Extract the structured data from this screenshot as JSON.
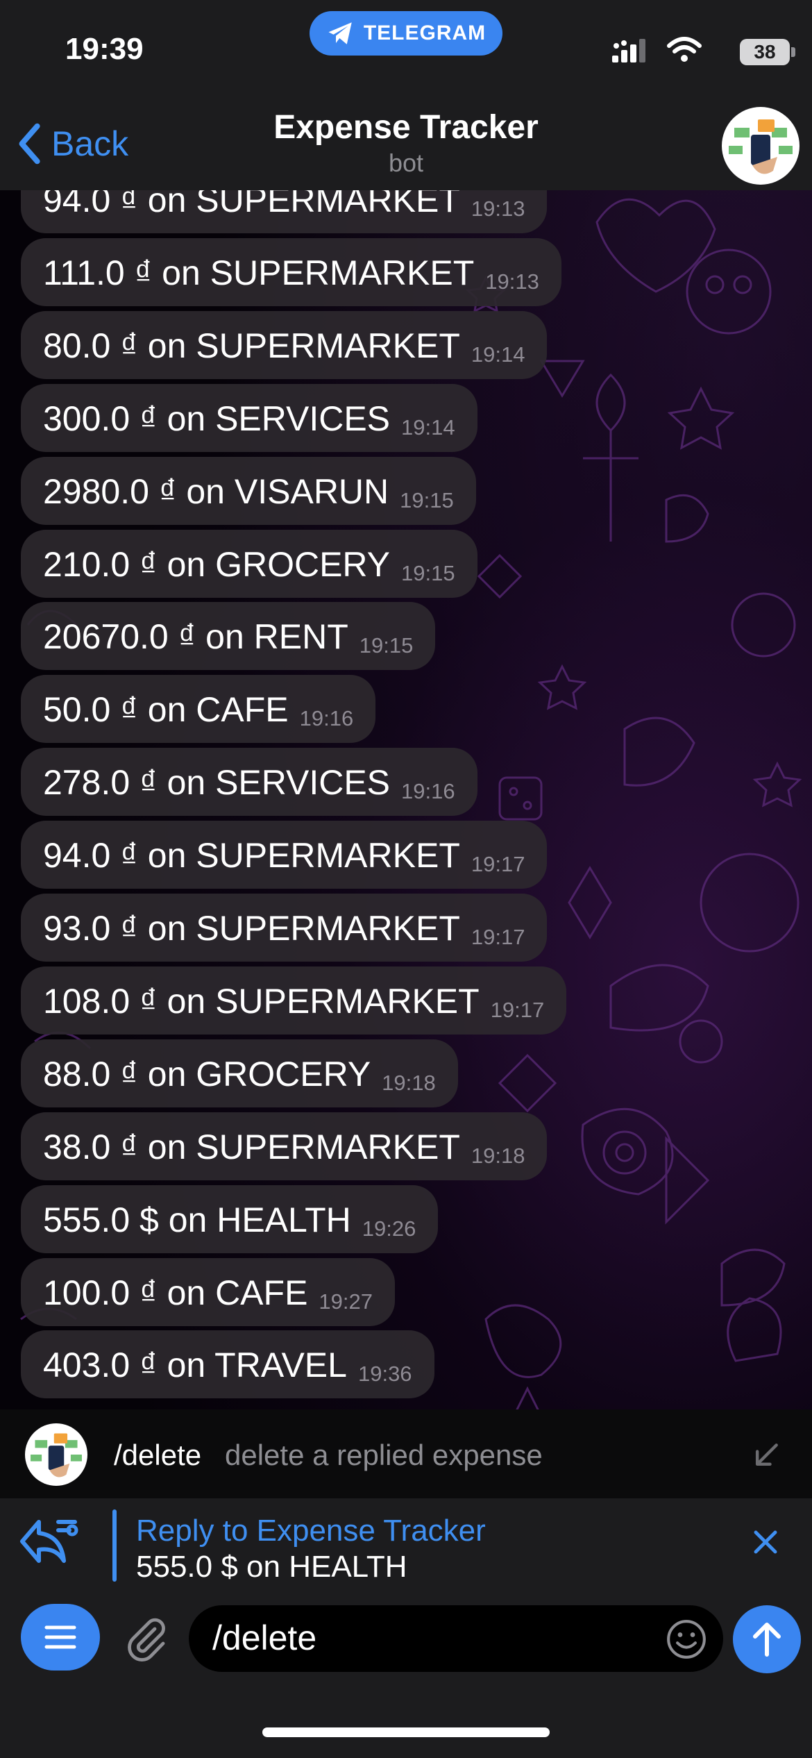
{
  "status_bar": {
    "time": "19:39",
    "pill_label": "TELEGRAM",
    "battery": "38"
  },
  "nav": {
    "back_label": "Back",
    "title": "Expense Tracker",
    "subtitle": "bot"
  },
  "messages": [
    {
      "text": "94.0 ₫ on SUPERMARKET",
      "time": "19:13"
    },
    {
      "text": "111.0 ₫ on SUPERMARKET",
      "time": "19:13"
    },
    {
      "text": "80.0 ₫ on SUPERMARKET",
      "time": "19:14"
    },
    {
      "text": "300.0 ₫ on SERVICES",
      "time": "19:14"
    },
    {
      "text": "2980.0 ₫ on VISARUN",
      "time": "19:15"
    },
    {
      "text": "210.0 ₫ on GROCERY",
      "time": "19:15"
    },
    {
      "text": "20670.0 ₫ on RENT",
      "time": "19:15"
    },
    {
      "text": "50.0 ₫ on CAFE",
      "time": "19:16"
    },
    {
      "text": "278.0 ₫ on SERVICES",
      "time": "19:16"
    },
    {
      "text": "94.0 ₫ on SUPERMARKET",
      "time": "19:17"
    },
    {
      "text": "93.0 ₫ on SUPERMARKET",
      "time": "19:17"
    },
    {
      "text": "108.0 ₫ on SUPERMARKET",
      "time": "19:17"
    },
    {
      "text": "88.0 ₫ on GROCERY",
      "time": "19:18"
    },
    {
      "text": "38.0 ₫ on SUPERMARKET",
      "time": "19:18"
    },
    {
      "text": "555.0 $ on HEALTH",
      "time": "19:26"
    },
    {
      "text": "100.0 ₫ on CAFE",
      "time": "19:27"
    },
    {
      "text": "403.0 ₫ on TRAVEL",
      "time": "19:36"
    }
  ],
  "command_suggestion": {
    "command": "/delete",
    "description": "delete a replied expense"
  },
  "reply": {
    "title": "Reply to Expense Tracker",
    "text": "555.0 $ on HEALTH"
  },
  "composer": {
    "value": "/delete"
  },
  "colors": {
    "accent": "#3a85f0",
    "bubble": "#2c282e",
    "bar": "#1c1c1e"
  }
}
